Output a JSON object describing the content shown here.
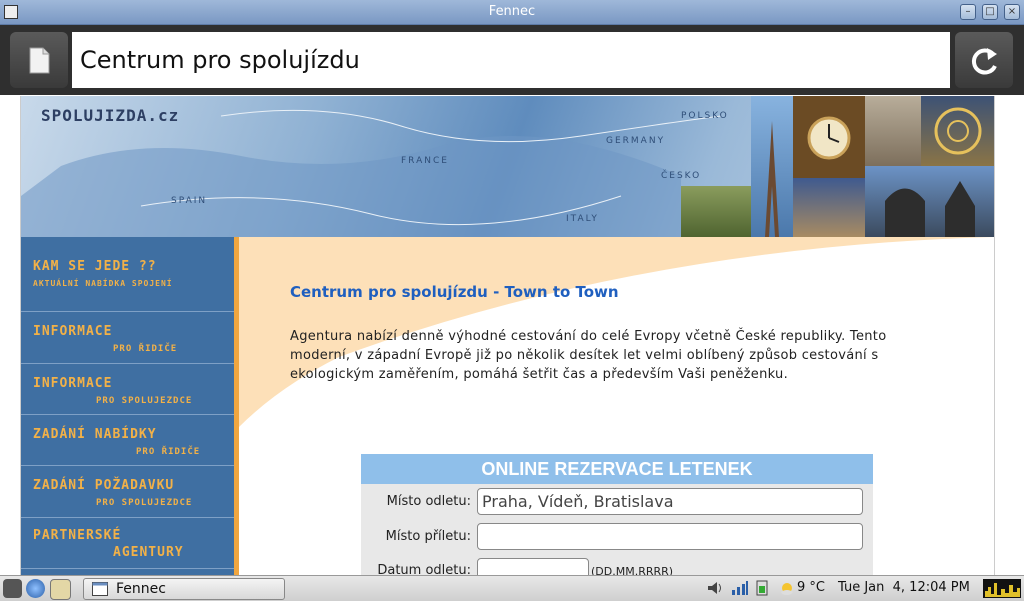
{
  "window": {
    "title": "Fennec"
  },
  "toolbar": {
    "url_title": "Centrum pro spolujízdu"
  },
  "site": {
    "logo": "SPOLUJIZDA.cz",
    "banner_countries": [
      "FRANCE",
      "SPAIN",
      "GERMANY",
      "ITALY",
      "POLSKO",
      "ČESKO"
    ],
    "nav": [
      {
        "line1": "KAM SE JEDE ??",
        "line2": "AKTUÁLNÍ NABÍDKA SPOJENÍ"
      },
      {
        "line1": "INFORMACE",
        "line2": "PRO ŘIDIČE"
      },
      {
        "line1": "INFORMACE",
        "line2": "PRO SPOLUJEZDCE"
      },
      {
        "line1": "ZADÁNÍ NABÍDKY",
        "line2": "PRO ŘIDIČE"
      },
      {
        "line1": "ZADÁNÍ POŽADAVKU",
        "line2": "PRO SPOLUJEZDCE"
      },
      {
        "line1": "PARTNERSKÉ",
        "line2": "AGENTURY"
      }
    ],
    "heading": "Centrum pro spolujízdu - Town to Town",
    "paragraph": "Agentura nabízí denně výhodné cestování do celé Evropy včetně České republiky. Tento moderní, v západní Evropě již po několik desítek let velmi oblíbený způsob cestování s ekologickým zaměřením, pomáhá šetřit čas a především Vaši peněženku.",
    "form": {
      "title": "ONLINE REZERVACE LETENEK",
      "fields": [
        {
          "label": "Místo odletu:",
          "value": "Praha, Vídeň, Bratislava"
        },
        {
          "label": "Místo příletu:",
          "value": ""
        },
        {
          "label": "Datum odletu:",
          "value": "",
          "hint": "(DD.MM.RRRR)"
        }
      ]
    }
  },
  "taskbar": {
    "task_label": "Fennec",
    "weather": "9 °C",
    "clock": "Tue Jan  4, 12:04 PM"
  }
}
